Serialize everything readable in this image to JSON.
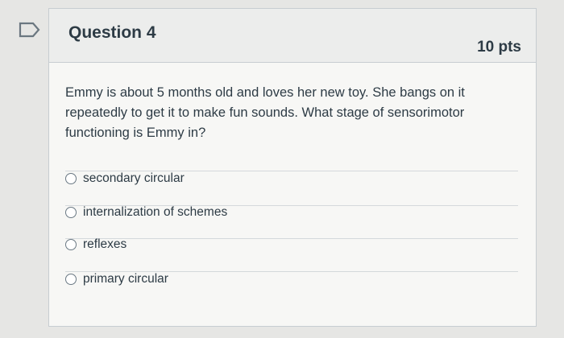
{
  "question": {
    "title": "Question 4",
    "points": "10 pts",
    "text": "Emmy is about 5 months old and loves her new toy. She bangs on it repeatedly to get it to make fun sounds. What stage of sensorimotor functioning is Emmy in?"
  },
  "answers": [
    {
      "label": "secondary circular",
      "selected": false
    },
    {
      "label": "internalization of schemes",
      "selected": false
    },
    {
      "label": "reflexes",
      "selected": false
    },
    {
      "label": "primary circular",
      "selected": false
    }
  ]
}
